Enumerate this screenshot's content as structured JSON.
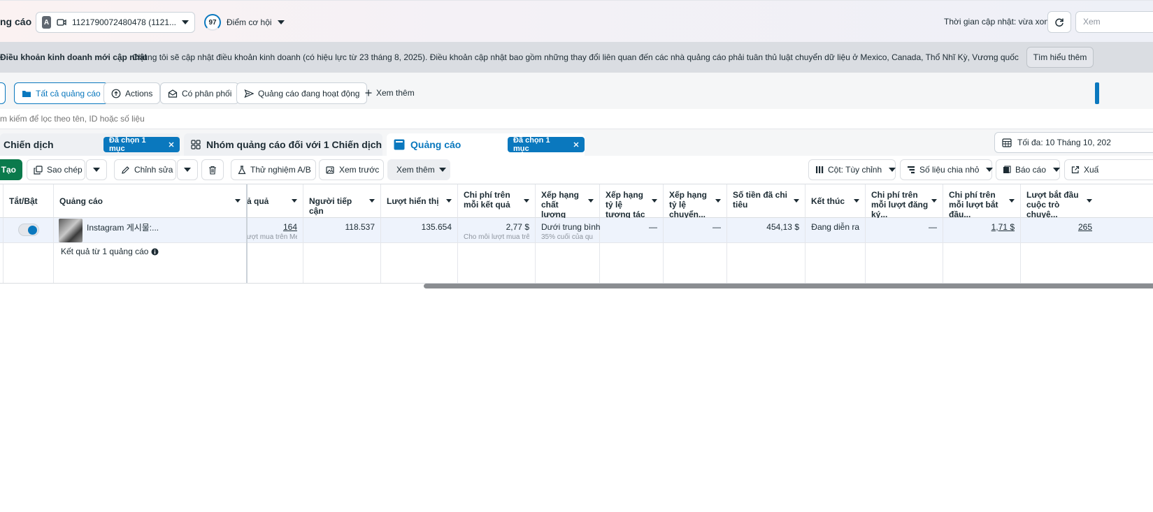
{
  "header": {
    "title": "ng cáo",
    "account_badge": "A",
    "account_id": "1121790072480478 (1121...",
    "opportunity_score": "97",
    "opportunity_label": "Điểm cơ hội",
    "updated_text": "Thời gian cập nhật: vừa xong",
    "view_label": "Xem"
  },
  "banner": {
    "title": "Điều khoản kinh doanh mới cập nhật",
    "text": "Chúng tôi sẽ cập nhật điều khoản kinh doanh (có hiệu lực từ 23 tháng 8, 2025). Điều khoản cập nhật bao gồm những thay đổi liên quan đến các nhà quảng cáo phải tuân thủ luật chuyển dữ liệu ở Mexico, Canada, Thổ Nhĩ Kỳ, Vương quốc Ả Rập Xê Út, Trung Mỹ và N...",
    "button": "Tìm hiểu thêm"
  },
  "filters": {
    "all_ads": "Tất cả quảng cáo",
    "actions": "Actions",
    "delivery": "Có phân phối",
    "active_ads": "Quảng cáo đang hoạt động",
    "see_more": "Xem thêm"
  },
  "search": {
    "placeholder": "m kiếm để lọc theo tên, ID hoặc số liệu"
  },
  "tabs": {
    "campaign": "Chiến dịch",
    "campaign_badge": "Đã chọn 1 mục",
    "adset": "Nhóm quảng cáo đối với 1 Chiến dịch",
    "ads": "Quảng cáo",
    "ads_badge": "Đã chọn 1 mục",
    "date_range": "Tối đa: 10 Tháng 10, 202"
  },
  "toolbar": {
    "create": "Tạo",
    "copy": "Sao chép",
    "edit": "Chỉnh sửa",
    "ab_test": "Thử nghiệm A/B",
    "preview": "Xem trước",
    "more": "Xem thêm",
    "columns": "Cột: Tùy chỉnh",
    "breakdown": "Số liệu chia nhỏ",
    "reports": "Báo cáo",
    "export": "Xuấ"
  },
  "table": {
    "headers": {
      "toggle": "Tắt/Bật",
      "ad": "Quảng cáo",
      "results": "ả quả",
      "reach": "Người tiếp cận",
      "impressions": "Lượt hiển thị",
      "cost_per_result": "Chi phí trên mỗi kết quả",
      "quality_ranking": "Xếp hạng chất lượng",
      "engagement_ranking": "Xếp hạng tỷ lệ tương tác",
      "conversion_ranking": "Xếp hạng tỷ lệ chuyển...",
      "amount_spent": "Số tiền đã chi tiêu",
      "ends": "Kết thúc",
      "cost_per_registration": "Chi phí trên mỗi lượt đăng ký...",
      "cost_per_start": "Chi phí trên mỗi lượt bắt đầu...",
      "conversations_started": "Lượt bắt đầu cuộc trò chuyệ..."
    },
    "row": {
      "ad_name": "Instagram 게시물:...",
      "results": "164",
      "results_sub": "ượt mua trên Meta",
      "reach": "118.537",
      "impressions": "135.654",
      "cost_per_result": "2,77 $",
      "cost_per_result_sub": "Cho mỗi lượt mua trê...",
      "quality_ranking": "Dưới trung bình",
      "quality_ranking_sub": "35% cuối của qu...",
      "engagement_ranking": "—",
      "conversion_ranking": "—",
      "amount_spent": "454,13 $",
      "ends": "Đang diễn ra",
      "cost_per_registration": "—",
      "cost_per_start": "1,71 $",
      "conversations_started": "265"
    },
    "footer_text": "Kết quả từ 1 quảng cáo"
  },
  "colors": {
    "accent": "#0a78be",
    "create_green": "#0b7a4c",
    "banner_bg": "#dadde2",
    "row_selected": "#eef3fc"
  }
}
